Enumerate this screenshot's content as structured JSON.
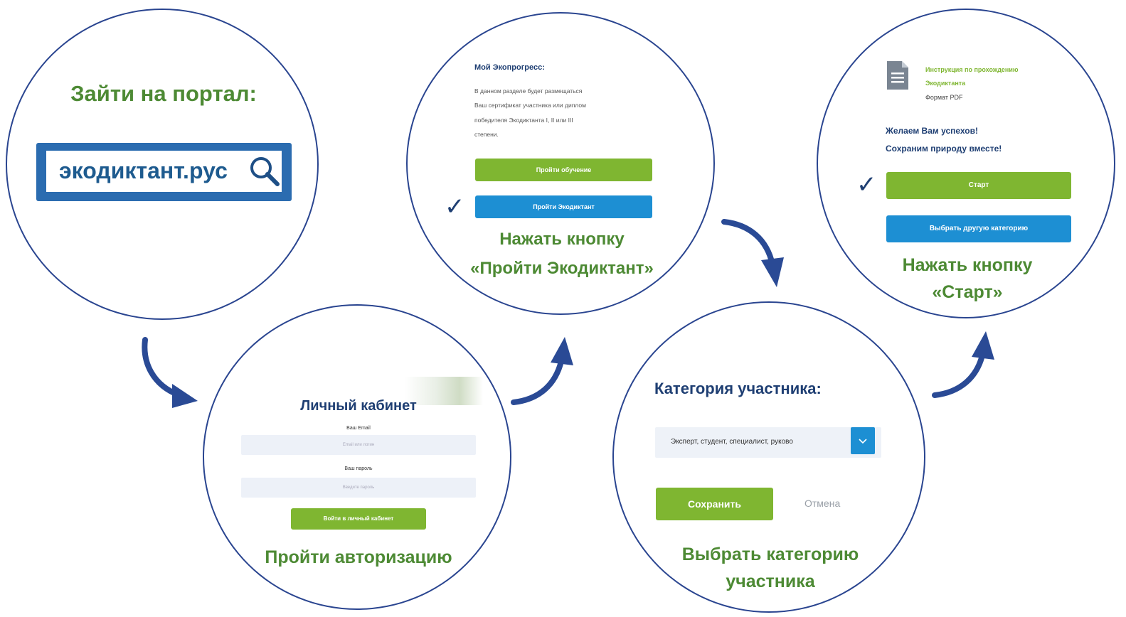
{
  "step1": {
    "heading": "Зайти на портал:",
    "url": "экодиктант.рус",
    "search_icon": "search-icon"
  },
  "step2": {
    "heading": "Личный кабинет",
    "email_label": "Ваш Email",
    "email_placeholder": "Email или логин",
    "password_label": "Ваш пароль",
    "password_placeholder": "Введите пароль",
    "login_button": "Войти в личный кабинет",
    "caption": "Пройти авторизацию"
  },
  "step3": {
    "heading": "Мой Экопрогресс:",
    "text_lines": [
      "В данном разделе будет размещаться",
      "Ваш сертификат участника или диплом",
      "победителя Экодиктанта I, II или III",
      "степени."
    ],
    "learn_button": "Пройти обучение",
    "dictation_button": "Пройти Экодиктант",
    "check": "✓",
    "caption_line1": "Нажать кнопку",
    "caption_line2": "«Пройти Экодиктант»"
  },
  "step4": {
    "heading": "Категория участника:",
    "select_value": "Эксперт, студент, специалист, руково",
    "save_button": "Сохранить",
    "cancel_link": "Отмена",
    "caption_line1": "Выбрать категорию",
    "caption_line2": "участника"
  },
  "step5": {
    "doc_title_line1": "Инструкция по прохождению",
    "doc_title_line2": "Экодиктанта",
    "doc_format": "Формат PDF",
    "wish_line1": "Желаем Вам успехов!",
    "wish_line2": "Сохраним природу вместе!",
    "start_button": "Старт",
    "other_category_button": "Выбрать другую категорию",
    "check": "✓",
    "caption_line1": "Нажать кнопку",
    "caption_line2": "«Старт»"
  },
  "colors": {
    "circle_border": "#2a4590",
    "green_text": "#4d8a34",
    "navy_text": "#1f3f73",
    "green_button": "#7fb631",
    "blue_button": "#1d8fd3"
  }
}
